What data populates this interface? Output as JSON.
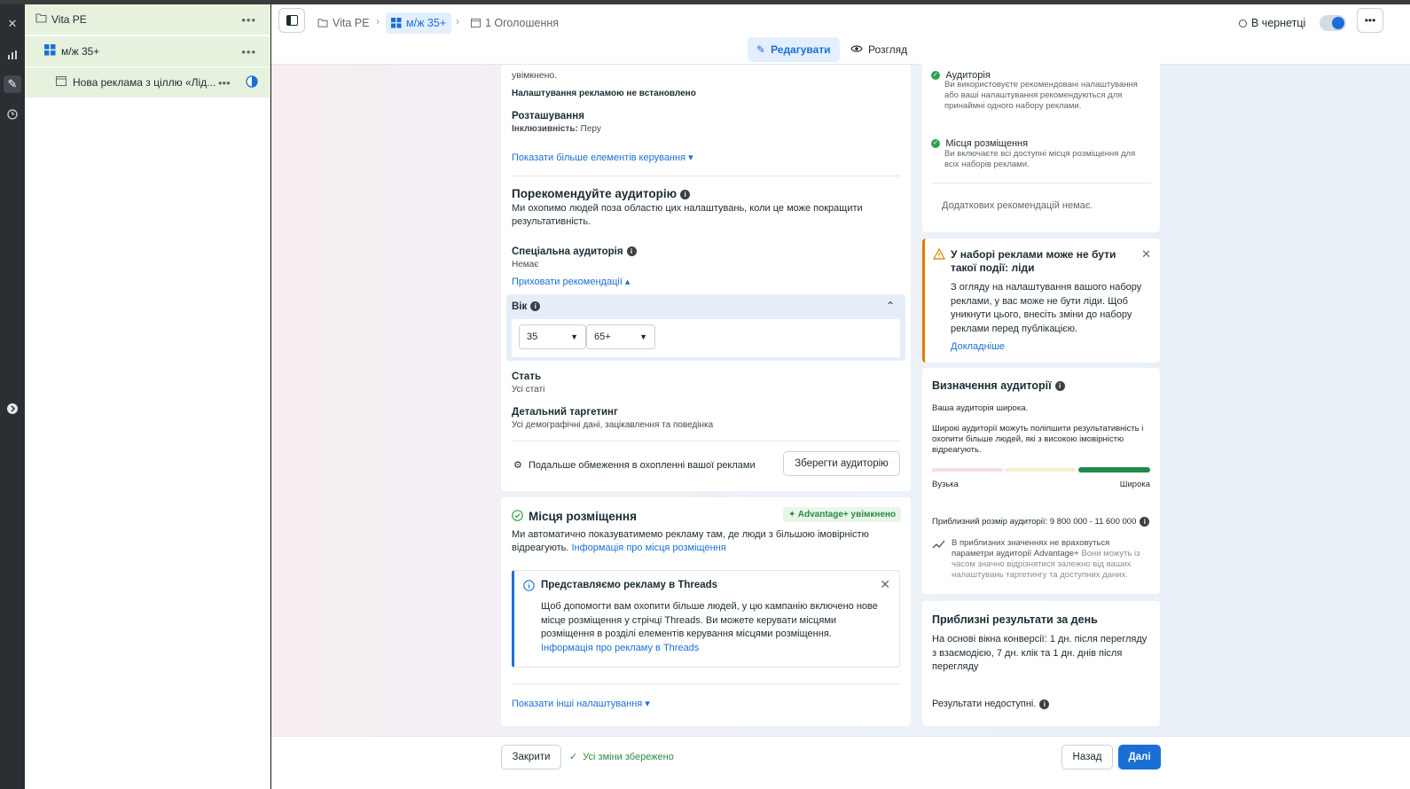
{
  "rail": {
    "icons": [
      "close-icon",
      "chart-icon",
      "pencil-icon",
      "clock-icon",
      "arrow-right-icon"
    ]
  },
  "nav": {
    "campaign": "Vita PE",
    "adset": "м/ж 35+",
    "ad": "Нова реклама з ціллю «Лід..."
  },
  "topbar": {
    "crumbs": [
      "Vita PE",
      "м/ж 35+",
      "1 Оголошення"
    ],
    "status": "В чернетці",
    "tab_edit": "Редагувати",
    "tab_view": "Розгляд"
  },
  "left": {
    "top_line": "увімкнено.",
    "no_controls": "Налаштування рекламою не встановлено",
    "location_title": "Розташування",
    "location_label": "Інклюзивність:",
    "location_value": "Перу",
    "show_more_controls": "Показати більше елементів керування ▾",
    "suggest_title": "Порекомендуйте аудиторію",
    "suggest_text": "Ми охопимо людей поза областю цих налаштувань, коли це може покращити результативність.",
    "custom_title": "Спеціальна аудиторія",
    "custom_value": "Немає",
    "hide_recs": "Приховати рекомендації ▴",
    "age_title": "Вік",
    "age_min": "35",
    "age_max": "65+",
    "gender_title": "Стать",
    "gender_value": "Усі статі",
    "targeting_title": "Детальний таргетинг",
    "targeting_value": "Усі демографічні дані, зацікавлення та поведінка",
    "restrictions": "Подальше обмеження в охопленні вашої реклами",
    "save_audience": "Зберегти аудиторію",
    "placements_title": "Місця розміщення",
    "advantage_badge": "✦ Advantage+ увімкнено",
    "placements_text": "Ми автоматично показуватимемо рекламу там, де люди з більшою імовірністю відреагують.",
    "placements_link": "Інформація про місця розміщення",
    "threads_title": "Представляємо рекламу в Threads",
    "threads_text": "Щоб допомогти вам охопити більше людей, у цю кампанію включено нове місце розміщення у стрічці Threads. Ви можете керувати місцями розміщення в розділі елементів керування місцями розміщення.",
    "threads_link": "Інформація про рекламу в Threads",
    "show_other": "Показати інші налаштування ▾"
  },
  "right": {
    "audience_title": "Аудиторія",
    "audience_text": "Ви використовуєте рекомендовані налаштування або ваші налаштування рекомендуються для принаймні одного набору реклами.",
    "placement_title": "Місця розміщення",
    "placement_text": "Ви включаєте всі доступні місця розміщення для всіх наборів реклами.",
    "no_more_recs": "Додаткових рекомендацій немає.",
    "warn_title": "У наборі реклами може не бути такої події: ліди",
    "warn_text": "З огляду на налаштування вашого набору реклами, у вас може не бути ліди. Щоб уникнути цього, внесіть зміни до набору реклами перед публікацією.",
    "warn_link": "Докладніше",
    "def_title": "Визначення аудиторії",
    "def_broad": "Ваша аудиторія широка.",
    "def_text": "Широкі аудиторії можуть поліпшити результативність і охопити більше людей, які з високою імовірністю відреагують.",
    "gauge_left": "Вузька",
    "gauge_right": "Широка",
    "size_text": "Приблизний розмір аудиторії: 9 800 000 - 11 600 000",
    "note_bold": "В приблизних значеннях не враховуться параметри аудиторії Advantage+",
    "note_rest": "Вони можуть із часом значно відрізнятися залежно від ваших налаштувань таргетингу та доступних даних.",
    "daily_title": "Приблизні результати за день",
    "daily_text": "На основі вікна конверсії: 1 дн. після перегляду з взаємодією, 7 дн. клік та 1 дн. днів після перегляду",
    "daily_na": "Результати недоступні."
  },
  "bottom": {
    "close": "Закрити",
    "saved": "Усі зміни збережено",
    "back": "Назад",
    "next": "Далі"
  },
  "colors": {
    "accent": "#1a6fd6",
    "success": "#31a24c",
    "warning": "#e07b00"
  }
}
